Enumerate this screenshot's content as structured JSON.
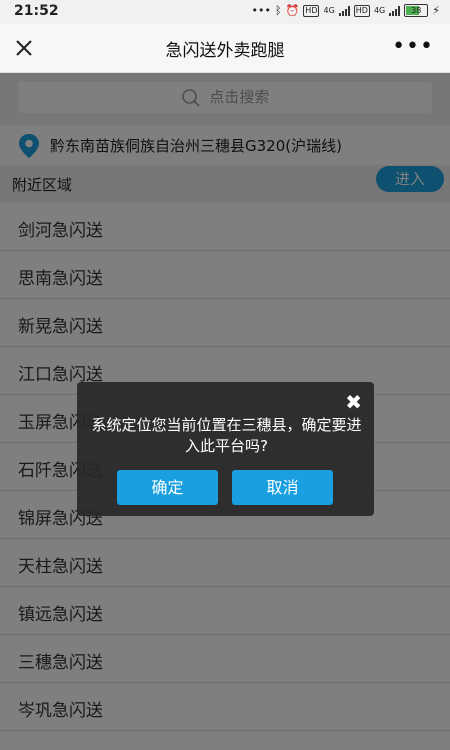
{
  "status_bar": {
    "time": "21:52",
    "network_tag_1": "4G",
    "network_tag_2": "4G",
    "hd_label": "HD",
    "battery": "38"
  },
  "titlebar": {
    "title": "急闪送外卖跑腿"
  },
  "search": {
    "placeholder": "点击搜索"
  },
  "location": {
    "text": "黔东南苗族侗族自治州三穗县G320(沪瑞线)"
  },
  "area": {
    "label": "附近区域",
    "enter_button": "进入"
  },
  "list": [
    "剑河急闪送",
    "思南急闪送",
    "新晃急闪送",
    "江口急闪送",
    "玉屏急闪送",
    "石阡急闪送",
    "锦屏急闪送",
    "天柱急闪送",
    "镇远急闪送",
    "三穗急闪送",
    "岑巩急闪送"
  ],
  "dialog": {
    "message": "系统定位您当前位置在三穗县，确定要进入此平台吗?",
    "confirm": "确定",
    "cancel": "取消"
  },
  "colors": {
    "accent": "#1aa0e0",
    "dialog_bg": "#282828"
  }
}
